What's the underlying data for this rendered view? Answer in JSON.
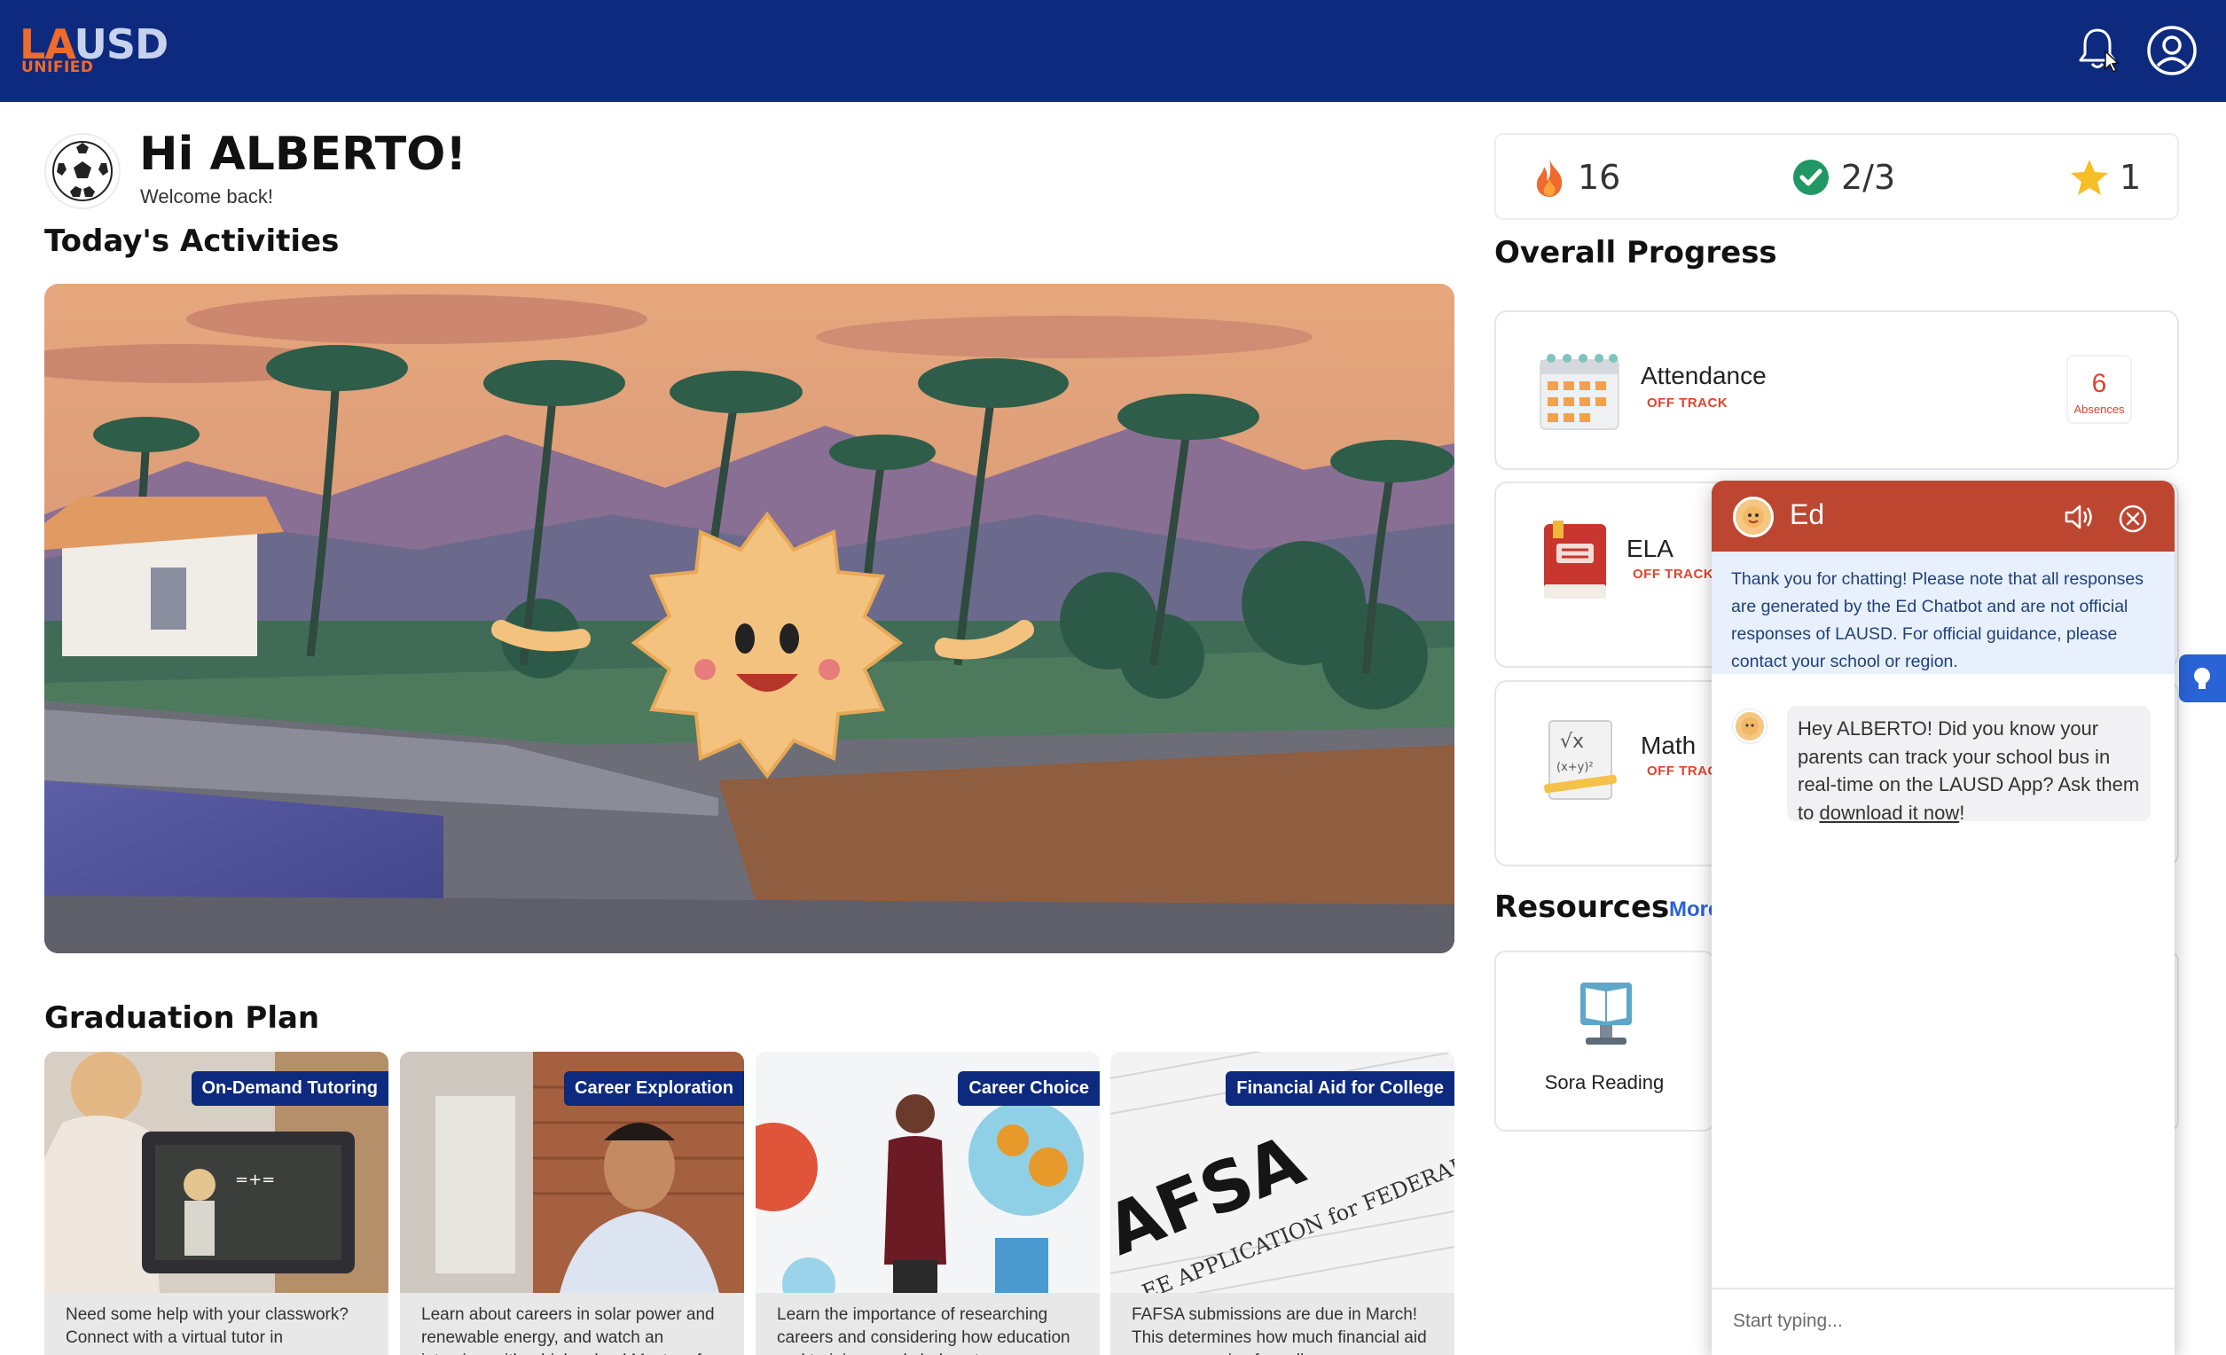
{
  "header": {
    "logo_main_a": "LA",
    "logo_main_b": "USD",
    "logo_sub": "UNIFIED",
    "bg_color": "#0d2a7f"
  },
  "greeting": {
    "title": "Hi ALBERTO!",
    "subtitle": "Welcome back!"
  },
  "activities": {
    "title": "Today's Activities"
  },
  "graduation": {
    "title": "Graduation Plan",
    "cards": [
      {
        "tag": "On-Demand Tutoring",
        "desc": "Need some help with your classwork? Connect with a virtual tutor in"
      },
      {
        "tag": "Career Exploration",
        "desc": "Learn about careers in solar power and renewable energy, and watch an interview with a high school Master of"
      },
      {
        "tag": "Career Choice",
        "desc": "Learn the importance of researching careers and considering how education and training needs help set"
      },
      {
        "tag": "Financial Aid for College",
        "desc": "FAFSA submissions are due in March! This determines how much financial aid you can receive for college"
      }
    ]
  },
  "stats": {
    "streak": "16",
    "completed": "2/3",
    "stars": "1"
  },
  "progress": {
    "title": "Overall Progress",
    "attendance": {
      "label": "Attendance",
      "status": "OFF TRACK",
      "count": "6",
      "count_label": "Absences"
    },
    "ela": {
      "label": "ELA",
      "status": "OFF TRACK"
    },
    "math": {
      "label": "Math",
      "status": "OFF TRACK"
    }
  },
  "resources": {
    "title": "Resources",
    "more": "More",
    "items": [
      {
        "label": "Sora Reading"
      }
    ]
  },
  "chat": {
    "name": "Ed",
    "notice": "Thank you for chatting! Please note that all responses are generated by the Ed Chatbot and are not official responses of LAUSD. For official guidance, please contact your school or region.",
    "message_text": "Hey ALBERTO! Did you know your parents can track your school bus in real-time on the LAUSD App? Ask them to ",
    "message_link": "download it now",
    "message_end": "!",
    "input_placeholder": "Start typing...",
    "header_color": "#bd4631"
  },
  "colors": {
    "off_track": "#e0442e",
    "accent_blue": "#2a63d6"
  }
}
